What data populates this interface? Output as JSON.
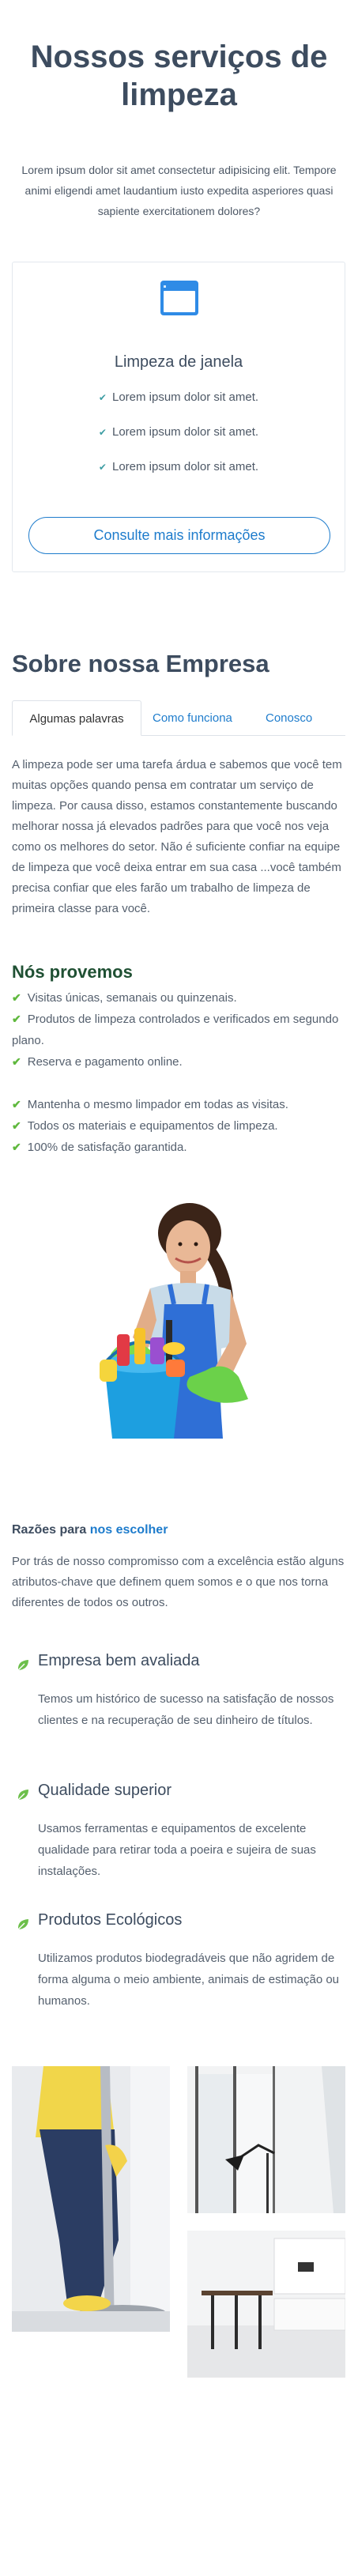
{
  "services": {
    "title": "Nossos serviços de limpeza",
    "intro": "Lorem ipsum dolor sit amet consectetur adipisicing elit. Tempore animi eligendi amet laudantium iusto expedita asperiores quasi sapiente exercitationem dolores?",
    "card": {
      "icon": "window-icon",
      "title": "Limpeza de janela",
      "items": [
        "Lorem ipsum dolor sit amet.",
        "Lorem ipsum dolor sit amet.",
        "Lorem ipsum dolor sit amet."
      ],
      "button": "Consulte mais informações"
    }
  },
  "about": {
    "title": "Sobre nossa Empresa",
    "tabs": [
      "Algumas palavras",
      "Como funciona",
      "Conosco"
    ],
    "text": "A limpeza pode ser uma tarefa árdua e sabemos que você tem muitas opções quando pensa em contratar um serviço de limpeza. Por causa disso, estamos constantemente buscando melhorar nossa já elevados padrões para que você nos veja como os melhores do setor. Não é suficiente confiar na equipe de limpeza que você deixa entrar em sua casa ...você também precisa confiar que eles farão um trabalho de limpeza de primeira classe para você.",
    "provemos_title": "Nós provemos",
    "list1": [
      "Visitas únicas, semanais ou quinzenais.",
      "Produtos de limpeza controlados e verificados em segundo plano.",
      "Reserva e pagamento online."
    ],
    "list2": [
      "Mantenha o mesmo limpador em todas as visitas.",
      "Todos os materiais e equipamentos de limpeza.",
      "100% de satisfação garantida."
    ]
  },
  "reasons": {
    "title_prefix": "Razões para",
    "title_highlight": "nos escolher",
    "text": "Por trás de nosso compromisso com a excelência estão alguns atributos-chave que definem quem somos e o que nos torna diferentes de todos os outros.",
    "features": [
      {
        "title": "Empresa bem avaliada",
        "text": "Temos um histórico de sucesso na satisfação de nossos clientes e na recuperação de seu dinheiro de títulos."
      },
      {
        "title": "Qualidade superior",
        "text": "Usamos ferramentas e equipamentos de excelente qualidade para retirar toda a poeira e sujeira de suas instalações."
      },
      {
        "title": "Produtos Ecológicos",
        "text": "Utilizamos produtos biodegradáveis que não agridem de forma alguma o meio ambiente, animais de estimação ou humanos."
      }
    ]
  },
  "colors": {
    "accent": "#1e7ccc",
    "heading": "#3d4c5f",
    "check": "#5fb83d",
    "leaf": "#6cbf4a"
  }
}
